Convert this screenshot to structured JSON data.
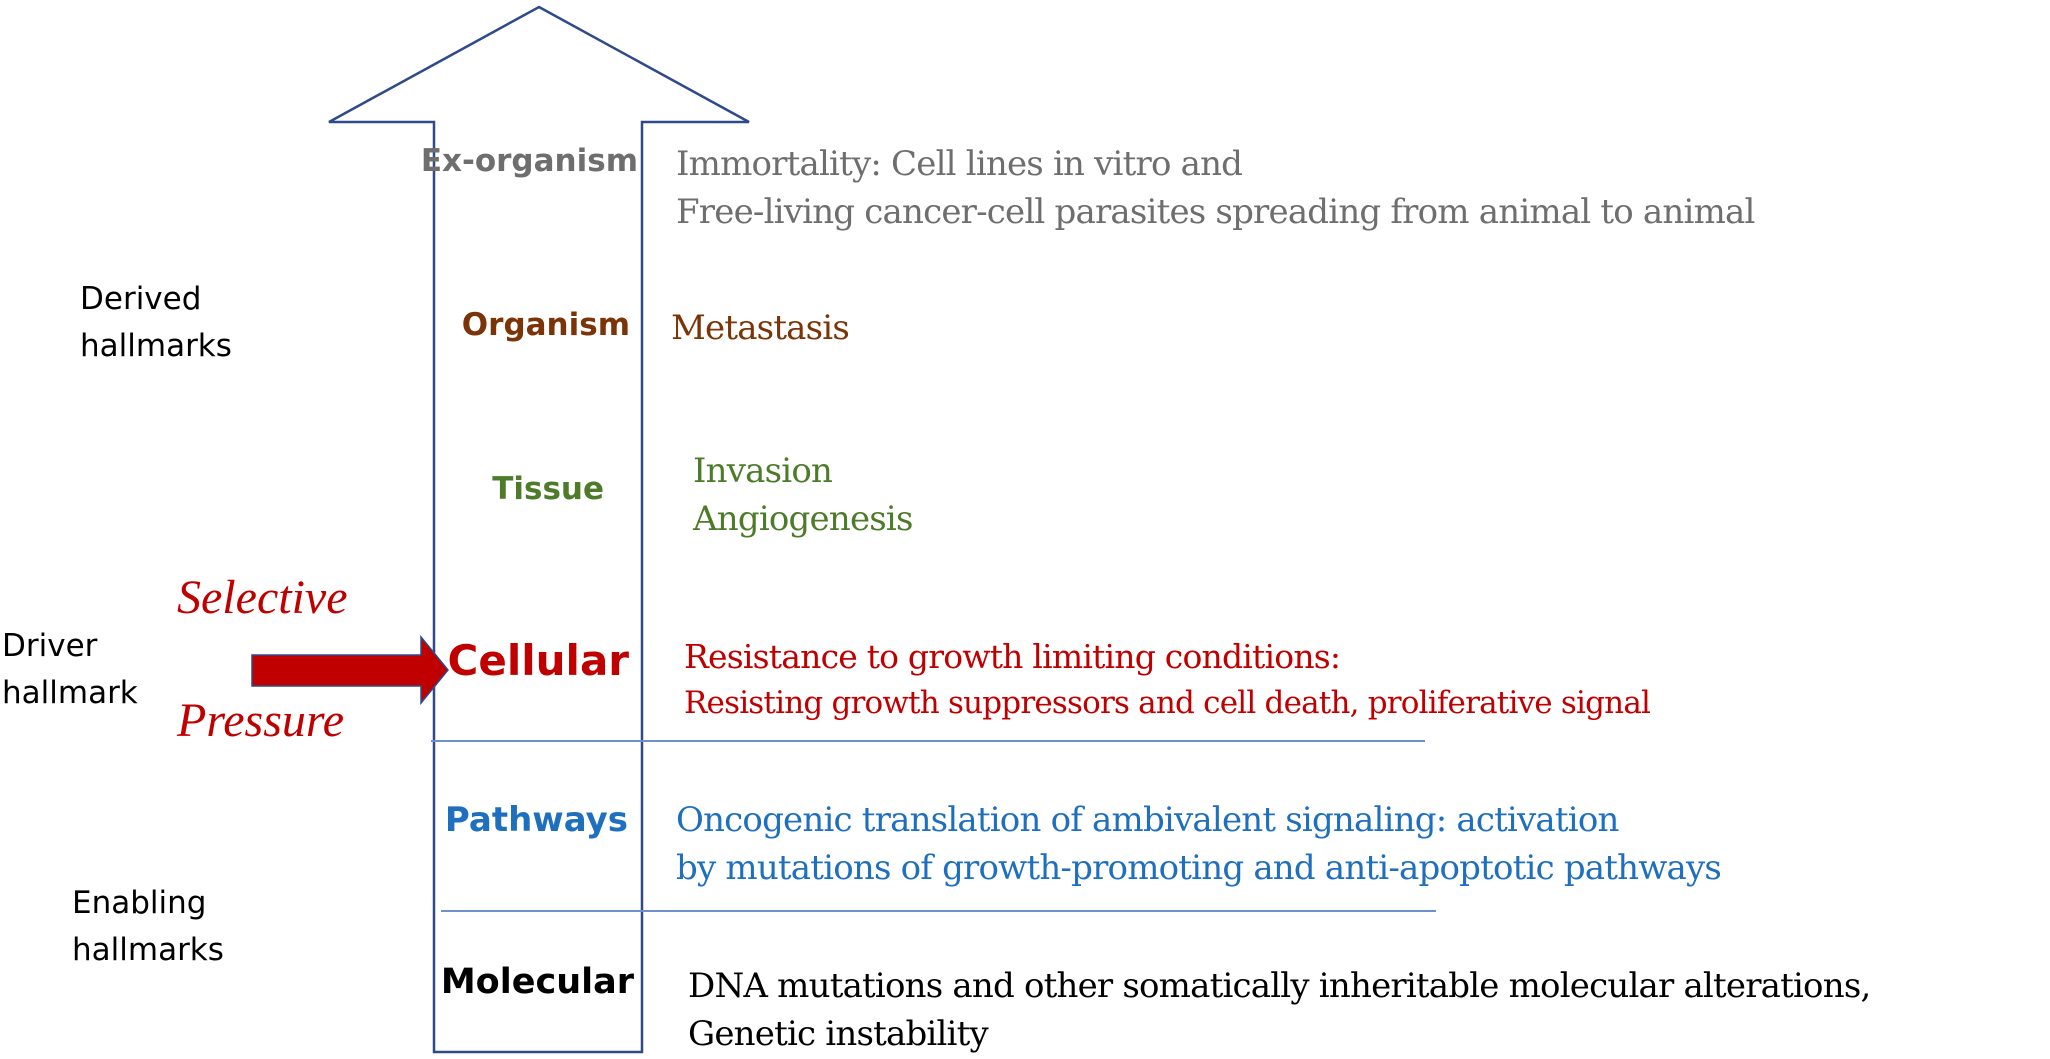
{
  "colors": {
    "arrow_outline": "#2e4a8a",
    "divider": "#6f8fd1",
    "ex_organism": "#6e6e6e",
    "organism": "#7b3308",
    "tissue": "#4e7b2a",
    "cellular": "#c00000",
    "pathways": "#1f6fbf",
    "molecular": "#000000",
    "selective_pressure": "#c00000"
  },
  "left_labels": {
    "derived": "Derived\nhallmarks",
    "driver": "Driver\nhallmark",
    "enabling": "Enabling\nhallmarks"
  },
  "selective_pressure": {
    "line1": "Selective",
    "line2": "Pressure",
    "arrow_icon": "right-arrow"
  },
  "levels": [
    {
      "label": "Ex-organism",
      "description": [
        "Immortality: Cell lines in vitro and",
        "Free-living cancer-cell parasites spreading from animal to animal"
      ]
    },
    {
      "label": "Organism",
      "description": [
        "Metastasis"
      ]
    },
    {
      "label": "Tissue",
      "description": [
        "Invasion",
        "Angiogenesis"
      ]
    },
    {
      "label": "Cellular",
      "description": [
        "Resistance to growth limiting conditions:",
        "Resisting growth suppressors and cell death, proliferative signal"
      ]
    },
    {
      "label": "Pathways",
      "description": [
        "Oncogenic translation of ambivalent signaling: activation",
        "by mutations of growth-promoting and anti-apoptotic pathways"
      ]
    },
    {
      "label": "Molecular",
      "description": [
        "DNA mutations and other somatically inheritable molecular alterations,",
        "Genetic instability"
      ]
    }
  ]
}
